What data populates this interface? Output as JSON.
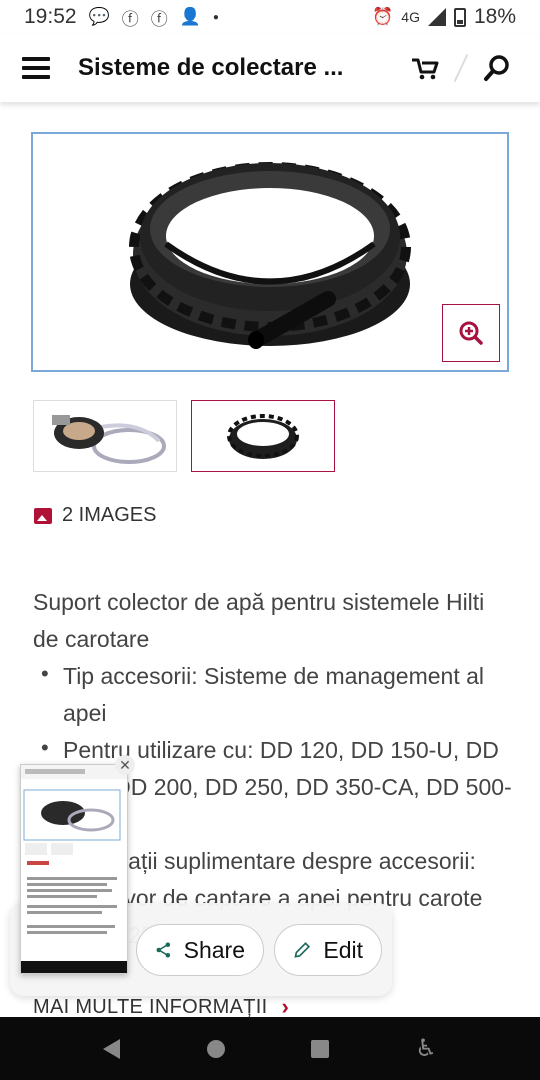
{
  "status_bar": {
    "time": "19:52",
    "network": "4G",
    "battery": "18%",
    "left_icons": [
      "chat-bubble-icon",
      "facebook-icon",
      "facebook-icon",
      "person-add-icon"
    ],
    "right_icons": [
      "alarm-icon",
      "signal-icon",
      "battery-icon"
    ]
  },
  "app_bar": {
    "title": "Sisteme de colectare ...",
    "icons": [
      "menu-icon",
      "cart-icon",
      "search-icon"
    ]
  },
  "product": {
    "images_count_label": "2 IMAGES",
    "description": "Suport colector de apă pentru sistemele Hilti de carotare",
    "bullets": [
      "Tip accesorii: Sisteme de management al apei",
      "Pentru utilizare cu: DD 120, DD 150-U, DD 160, DD 200, DD 250, DD 350-CA, DD 500-CA",
      "Informații suplimentare despre accesorii: Rezervor de captare a apei pentru carote de 60-250 mm"
    ],
    "more_info_label": "MAI MULTE INFORMAȚII"
  },
  "screenshot_overlay": {
    "share_label": "Share",
    "edit_label": "Edit",
    "close_glyph": "✕"
  },
  "colors": {
    "accent": "#b01237",
    "image_border": "#7aa9d9",
    "navbar": "#0a0a0a"
  }
}
